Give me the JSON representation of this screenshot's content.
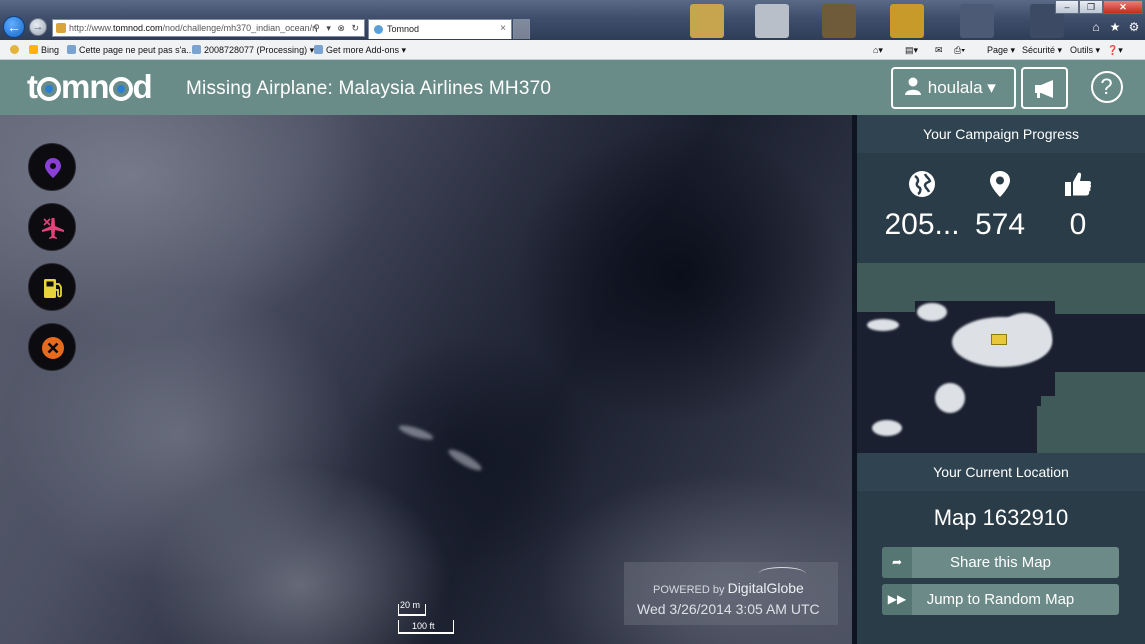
{
  "browser": {
    "url_pre": "http://www.",
    "url_domain": "tomnod.com",
    "url_path": "/nod/challenge/mh370_indian_ocean/n",
    "tab_title": "Tomnod",
    "tab_close": "×",
    "win_min": "–",
    "win_max": "❐",
    "win_close": "✕",
    "addr_icons": "⚲ ▾ ⊗ ↻",
    "favorites": [
      {
        "label": "Bing"
      },
      {
        "label": "Cette page ne peut pas s'a..."
      },
      {
        "label": "2008728077 (Processing) ▾"
      },
      {
        "label": "Get more Add-ons ▾"
      }
    ],
    "commands": {
      "page": "Page ▾",
      "security": "Sécurité ▾",
      "tools": "Outils ▾",
      "help": "❓▾"
    }
  },
  "header": {
    "logo_pre": "t",
    "logo_mid": "mn",
    "logo_post": "d",
    "title": "Missing Airplane: Malaysia Airlines MH370",
    "username": "houlala ▾",
    "help_glyph": "?"
  },
  "map": {
    "scale_small": "20 m",
    "scale_large": "100 ft",
    "credit_prefix": "POWERED by",
    "credit_brand": "DigitalGlobe",
    "timestamp": "Wed 3/26/2014 3:05 AM UTC"
  },
  "panel": {
    "progress_title": "Your Campaign Progress",
    "stats": [
      {
        "icon": "globe-icon",
        "value": "205..."
      },
      {
        "icon": "map-pin-icon",
        "value": "574"
      },
      {
        "icon": "thumbs-up-icon",
        "value": "0"
      }
    ],
    "location_title": "Your Current Location",
    "map_name": "Map 1632910",
    "share_label": "Share this Map",
    "random_label": "Jump to Random Map"
  },
  "colors": {
    "header_bg": "#6a8c88",
    "panel_bg": "#293c48",
    "button_bg": "#6c8a88",
    "marker_purple": "#8a3fd6",
    "plane_pink": "#e0457a",
    "fuel_yellow": "#e7d43a",
    "close_orange": "#e86a1c",
    "minimap_marker": "#e8c83a"
  }
}
